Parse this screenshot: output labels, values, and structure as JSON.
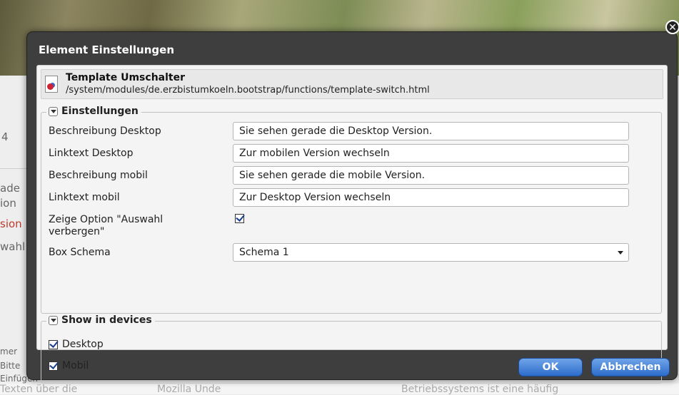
{
  "background": {
    "fragments": [
      "4",
      "ade",
      "ion",
      "sion",
      "wahl",
      "mer",
      "Bitte",
      "Einfügen",
      "Texten über die"
    ],
    "bottom": [
      "Betriebssystems ist eine häufig",
      "Mozilla Unde"
    ]
  },
  "dialog": {
    "title": "Element Einstellungen",
    "close_icon": "close-icon",
    "element": {
      "title": "Template Umschalter",
      "path": "/system/modules/de.erzbistumkoeln.bootstrap/functions/template-switch.html"
    },
    "settings": {
      "legend": "Einstellungen",
      "fields": [
        {
          "label": "Beschreibung Desktop",
          "value": "Sie sehen gerade die Desktop Version."
        },
        {
          "label": "Linktext Desktop",
          "value": "Zur mobilen Version wechseln"
        },
        {
          "label": "Beschreibung mobil",
          "value": "Sie sehen gerade die mobile Version."
        },
        {
          "label": "Linktext mobil",
          "value": "Zur Desktop Version wechseln"
        }
      ],
      "option_label": "Zeige Option \"Auswahl verbergen\"",
      "option_checked": true,
      "schema_label": "Box Schema",
      "schema_value": "Schema 1"
    },
    "devices": {
      "legend": "Show in devices",
      "items": [
        {
          "label": "Desktop",
          "checked": true
        },
        {
          "label": "Mobil",
          "checked": true
        }
      ]
    },
    "buttons": {
      "ok": "OK",
      "cancel": "Abbrechen"
    }
  }
}
